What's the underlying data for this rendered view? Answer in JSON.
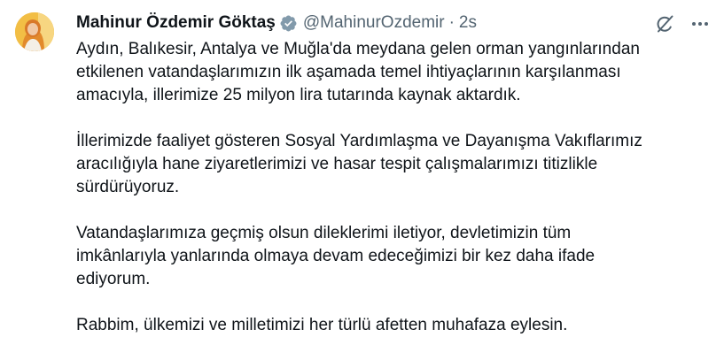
{
  "author": {
    "display_name": "Mahinur Özdemir Göktaş",
    "handle": "@MahinurOzdemir",
    "separator": "·",
    "time": "2s",
    "verified": true
  },
  "icons": {
    "verified": "verified-badge-icon",
    "grok": "grok-icon",
    "more": "more-icon"
  },
  "colors": {
    "verified_badge": "#829aab",
    "secondary_text": "#536471",
    "primary_text": "#0f1419"
  },
  "paragraphs": [
    {
      "lines": [
        "Aydın, Balıkesir, Antalya ve Muğla'da meydana gelen orman yangınlarından",
        "etkilenen vatandaşlarımızın ilk aşamada temel ihtiyaçlarının karşılanması",
        "amacıyla, illerimize 25 milyon lira tutarında kaynak aktardık."
      ]
    },
    {
      "lines": [
        "İllerimizde faaliyet gösteren Sosyal Yardımlaşma ve Dayanışma Vakıflarımız",
        "aracılığıyla hane ziyaretlerimizi ve hasar tespit çalışmalarımızı titizlikle",
        "sürdürüyoruz."
      ]
    },
    {
      "lines": [
        "Vatandaşlarımıza geçmiş olsun dileklerimi iletiyor, devletimizin tüm",
        "imkânlarıyla yanlarında olmaya devam edeceğimizi bir kez daha ifade",
        "ediyorum."
      ]
    },
    {
      "lines": [
        "Rabbim, ülkemizi ve milletimizi her türlü afetten muhafaza eylesin."
      ]
    }
  ]
}
